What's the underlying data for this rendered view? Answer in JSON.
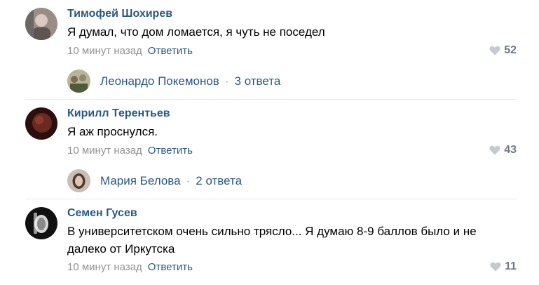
{
  "comments": [
    {
      "author": "Тимофей Шохирев",
      "text": "Я думал, что дом ломается, я чуть не поседел",
      "time": "10 минут назад",
      "reply_label": "Ответить",
      "likes": "52",
      "thread": {
        "name": "Леонардо Покемонов",
        "separator": "·",
        "count": "3 ответа"
      }
    },
    {
      "author": "Кирилл Терентьев",
      "text": "Я аж проснулся.",
      "time": "10 минут назад",
      "reply_label": "Ответить",
      "likes": "43",
      "thread": {
        "name": "Мария Белова",
        "separator": "·",
        "count": "2 ответа"
      }
    },
    {
      "author": "Семен Гусев",
      "text": "В университетском очень сильно трясло... Я думаю 8-9 баллов было и не далеко от Иркутска",
      "time": "10 минут назад",
      "reply_label": "Ответить",
      "likes": "11"
    }
  ],
  "icons": {
    "like": "heart-icon"
  },
  "colors": {
    "link": "#2a5885",
    "meta": "#939393",
    "like": "#6f7985"
  }
}
